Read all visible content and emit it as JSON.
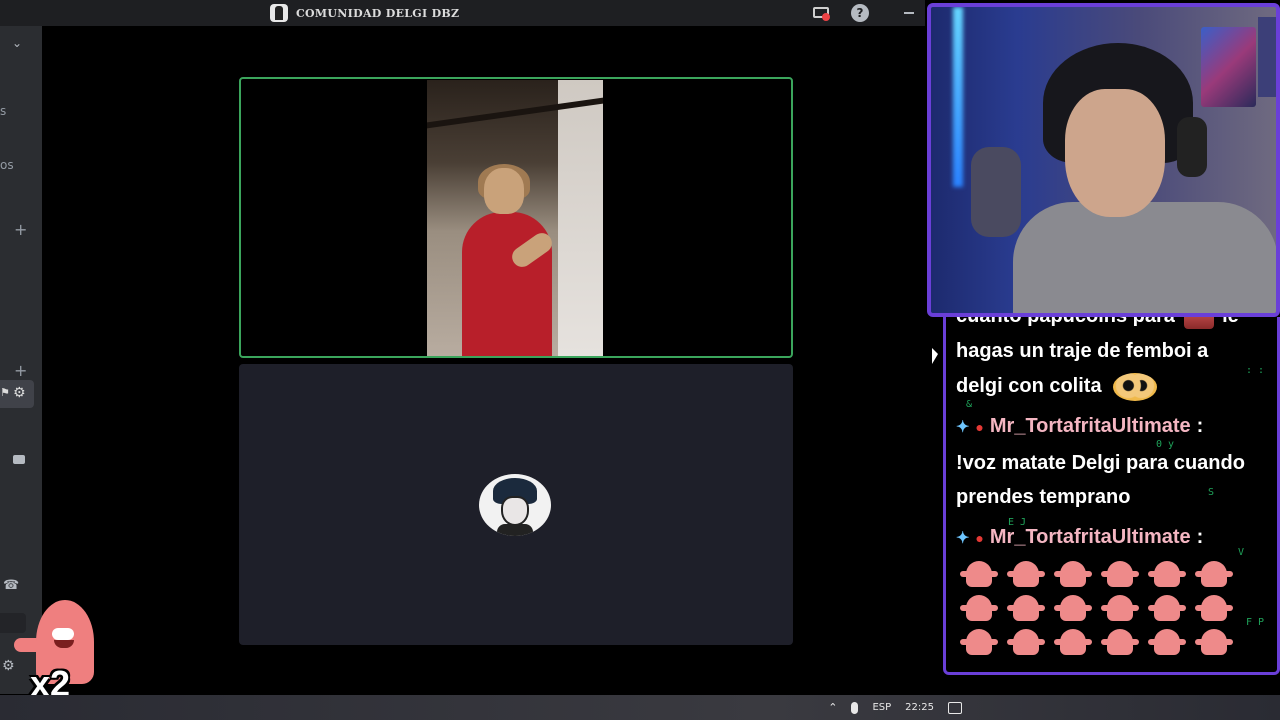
{
  "window": {
    "title": "COMUNIDAD DELGI DBZ"
  },
  "sidebar": {
    "partial_text_1": "s",
    "partial_text_2": "os"
  },
  "webcam": {
    "accent": "#6a3fd8"
  },
  "chat": {
    "message1_lines": [
      "cuanto papucoins para",
      "le",
      "hagas un traje de femboi a",
      "delgi con colita"
    ],
    "message2": {
      "username": "Mr_TortafritaUltimate",
      "lines": [
        "!voz matate Delgi para cuando",
        "prendes temprano"
      ]
    },
    "message3": {
      "username": "Mr_TortafritaUltimate",
      "emote_count": 18
    },
    "username_color": "#f4b6c2"
  },
  "overlay": {
    "multiplier": "x2"
  },
  "taskbar": {
    "language": "ESP",
    "time": "22:25"
  }
}
